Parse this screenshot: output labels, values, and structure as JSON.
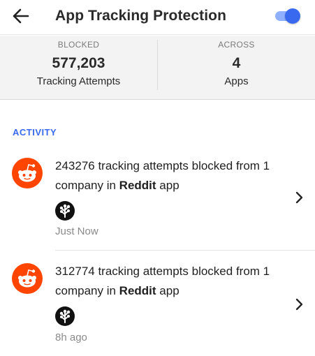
{
  "appbar": {
    "title": "App Tracking Protection",
    "back_icon": "arrow-back-icon",
    "toggle_state": "on",
    "accent": "#3969ef"
  },
  "stats": {
    "blocked_caption": "BLOCKED",
    "blocked_value": "577,203",
    "blocked_label": "Tracking Attempts",
    "across_caption": "ACROSS",
    "across_value": "4",
    "across_label": "Apps"
  },
  "activity": {
    "section_title": "ACTIVITY",
    "items": [
      {
        "count": "243276",
        "text_mid": " tracking attempts blocked from 1 company in ",
        "app": "Reddit",
        "text_end": " app",
        "time": "Just Now",
        "app_icon": "reddit-icon",
        "tracker_icon": "tracker-tree-icon"
      },
      {
        "count": "312774",
        "text_mid": " tracking attempts blocked from 1 company in ",
        "app": "Reddit",
        "text_end": " app",
        "time": "8h ago",
        "app_icon": "reddit-icon",
        "tracker_icon": "tracker-tree-icon"
      }
    ]
  }
}
